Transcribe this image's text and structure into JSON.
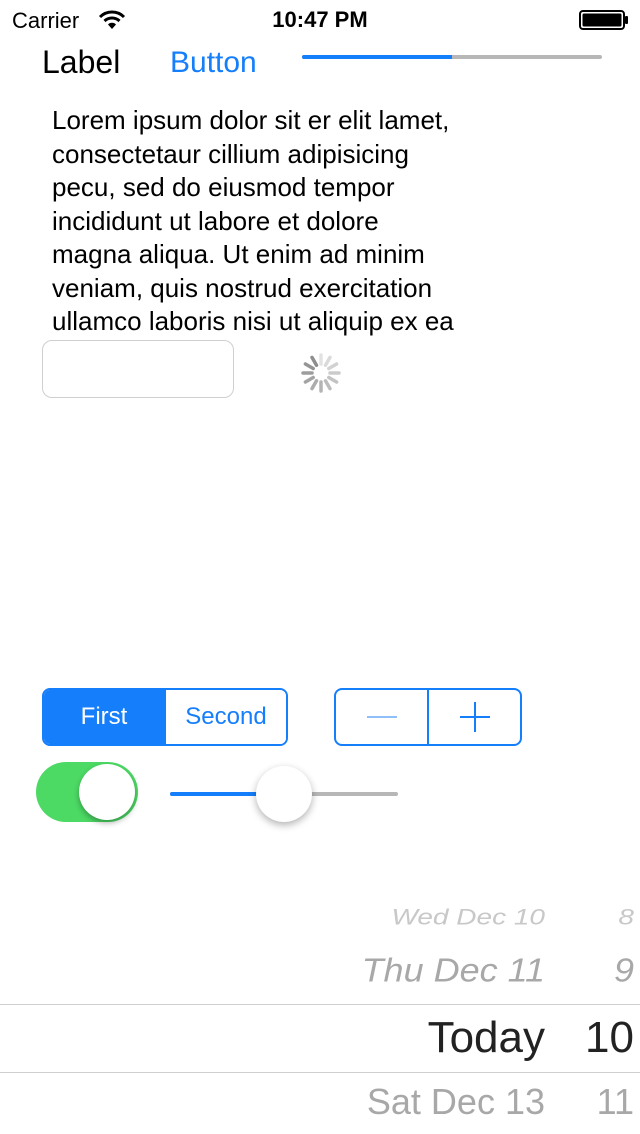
{
  "status_bar": {
    "carrier": "Carrier",
    "time": "10:47 PM"
  },
  "top_row": {
    "label": "Label",
    "button": "Button",
    "progress": 0.5
  },
  "text_view": {
    "lines": [
      "Lorem ipsum dolor sit er elit lamet,",
      "consectetaur cillium adipisicing",
      "pecu, sed do eiusmod tempor",
      "incididunt ut labore et dolore",
      "magna aliqua. Ut enim ad minim",
      "veniam, quis nostrud exercitation",
      "ullamco laboris nisi ut aliquip ex ea"
    ]
  },
  "text_field": {
    "value": "",
    "placeholder": ""
  },
  "segmented": {
    "segments": [
      "First",
      "Second"
    ],
    "selected": "First"
  },
  "stepper": {
    "decrement_label": "−",
    "increment_label": "+"
  },
  "switch": {
    "on": true
  },
  "slider": {
    "value": 0.5
  },
  "date_picker": {
    "rows": [
      {
        "date": "Wed Dec 10",
        "hour": "8"
      },
      {
        "date": "Thu Dec 11",
        "hour": "9"
      },
      {
        "date": "Today",
        "hour": "10"
      },
      {
        "date": "Sat Dec 13",
        "hour": "11"
      }
    ],
    "selected_index": 2
  },
  "colors": {
    "tint": "#157efb",
    "switch_on": "#4cd964",
    "track": "#b7b7b7"
  }
}
